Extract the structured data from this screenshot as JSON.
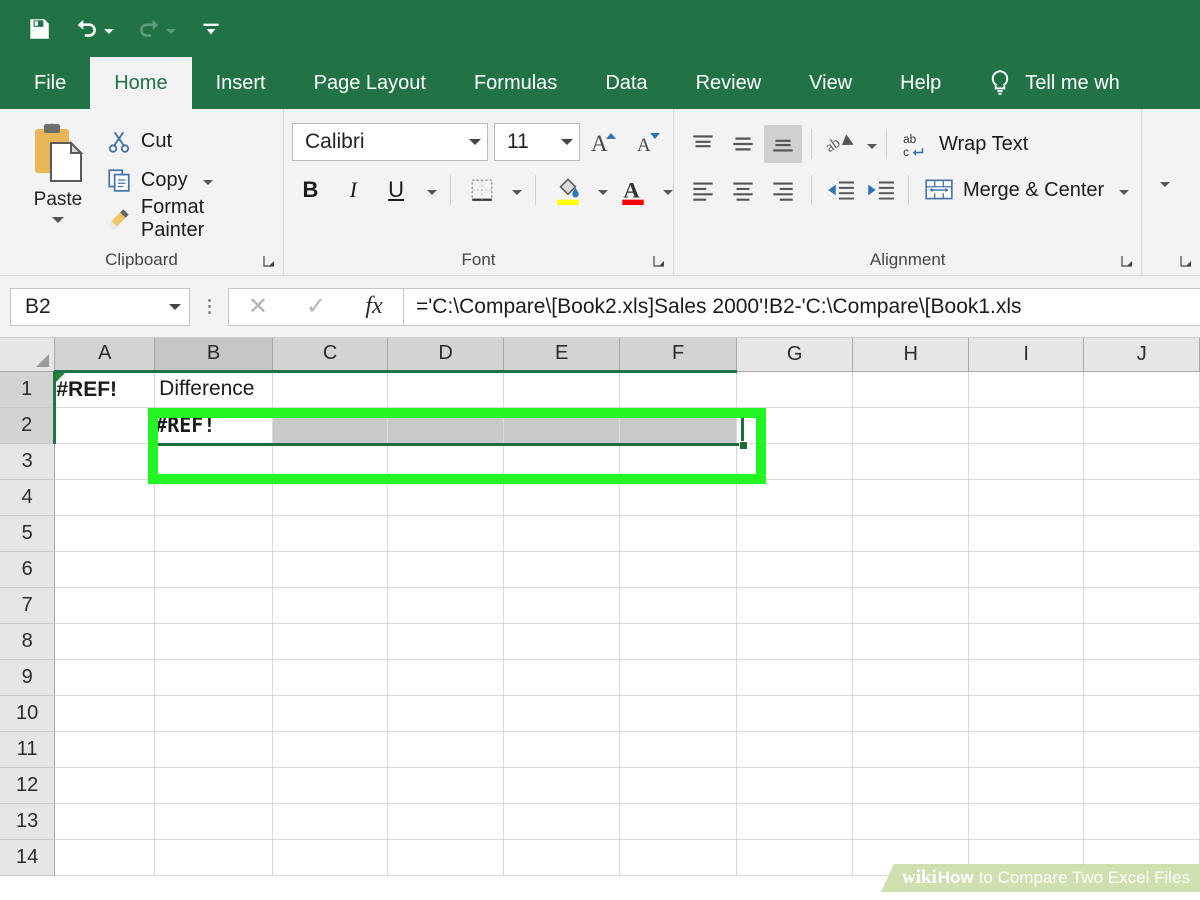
{
  "quick_access": {
    "items": [
      {
        "name": "save",
        "icon": "save-icon",
        "label": "Save"
      },
      {
        "name": "undo",
        "icon": "undo-icon",
        "label": "Undo"
      },
      {
        "name": "redo",
        "icon": "redo-icon",
        "label": "Redo"
      },
      {
        "name": "customize",
        "icon": "customize-quick-access-icon",
        "label": "Customize Quick Access Toolbar"
      }
    ]
  },
  "ribbon": {
    "tabs": [
      {
        "label": "File",
        "active": false
      },
      {
        "label": "Home",
        "active": true
      },
      {
        "label": "Insert",
        "active": false
      },
      {
        "label": "Page Layout",
        "active": false
      },
      {
        "label": "Formulas",
        "active": false
      },
      {
        "label": "Data",
        "active": false
      },
      {
        "label": "Review",
        "active": false
      },
      {
        "label": "View",
        "active": false
      },
      {
        "label": "Help",
        "active": false
      }
    ],
    "tell_me": "Tell me wh",
    "groups": {
      "clipboard": {
        "label": "Clipboard",
        "paste": "Paste",
        "cut": "Cut",
        "copy": "Copy",
        "format_painter": "Format Painter"
      },
      "font": {
        "label": "Font",
        "font_name": "Calibri",
        "font_size": "11",
        "bold": "B",
        "italic": "I",
        "underline": "U"
      },
      "alignment": {
        "label": "Alignment",
        "wrap_text": "Wrap Text",
        "merge_center": "Merge & Center"
      }
    }
  },
  "formula_bar": {
    "name_box": "B2",
    "cancel": "✕",
    "enter": "✓",
    "insert_function": "fx",
    "formula": "='C:\\Compare\\[Book2.xls]Sales 2000'!B2-'C:\\Compare\\[Book1.xls"
  },
  "grid": {
    "columns": [
      "A",
      "B",
      "C",
      "D",
      "E",
      "F",
      "G",
      "H",
      "I",
      "J"
    ],
    "rows": [
      "1",
      "2",
      "3",
      "4",
      "5",
      "6",
      "7",
      "8",
      "9",
      "10",
      "11",
      "12",
      "13",
      "14"
    ],
    "highlighted_columns": [
      "A",
      "B",
      "C",
      "D",
      "E",
      "F"
    ],
    "active_column": "B",
    "highlighted_rows": [
      "1",
      "2"
    ],
    "cells": {
      "A1": "#REF!",
      "B1": "Difference",
      "B2": "#REF!"
    },
    "selection_range": "B2:F2",
    "active_cell": "B2"
  },
  "watermark": {
    "brand_wiki": "wiki",
    "brand_how": "How",
    "text": "to Compare Two Excel Files"
  },
  "colors": {
    "excel_green": "#217346",
    "annotation_green": "#22f521",
    "selection_border": "#1e6b3c",
    "selection_fill": "#c9c9c9"
  }
}
